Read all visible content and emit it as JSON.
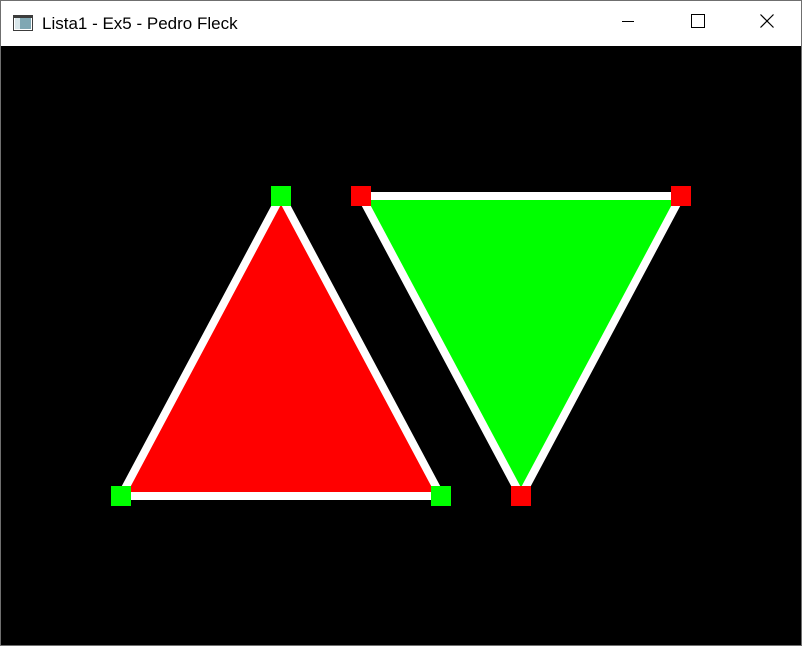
{
  "window": {
    "title": "Lista1 - Ex5 - Pedro Fleck",
    "controls": {
      "minimize": "minimize-icon",
      "maximize": "maximize-icon",
      "close": "close-icon"
    }
  },
  "colors": {
    "background": "#000000",
    "outline": "#ffffff",
    "red": "#ff0000",
    "green": "#00ff00"
  },
  "shapes": [
    {
      "name": "red-triangle",
      "fill": "#ff0000",
      "vertex_color": "#00ff00"
    },
    {
      "name": "green-triangle",
      "fill": "#00ff00",
      "vertex_color": "#ff0000"
    }
  ]
}
